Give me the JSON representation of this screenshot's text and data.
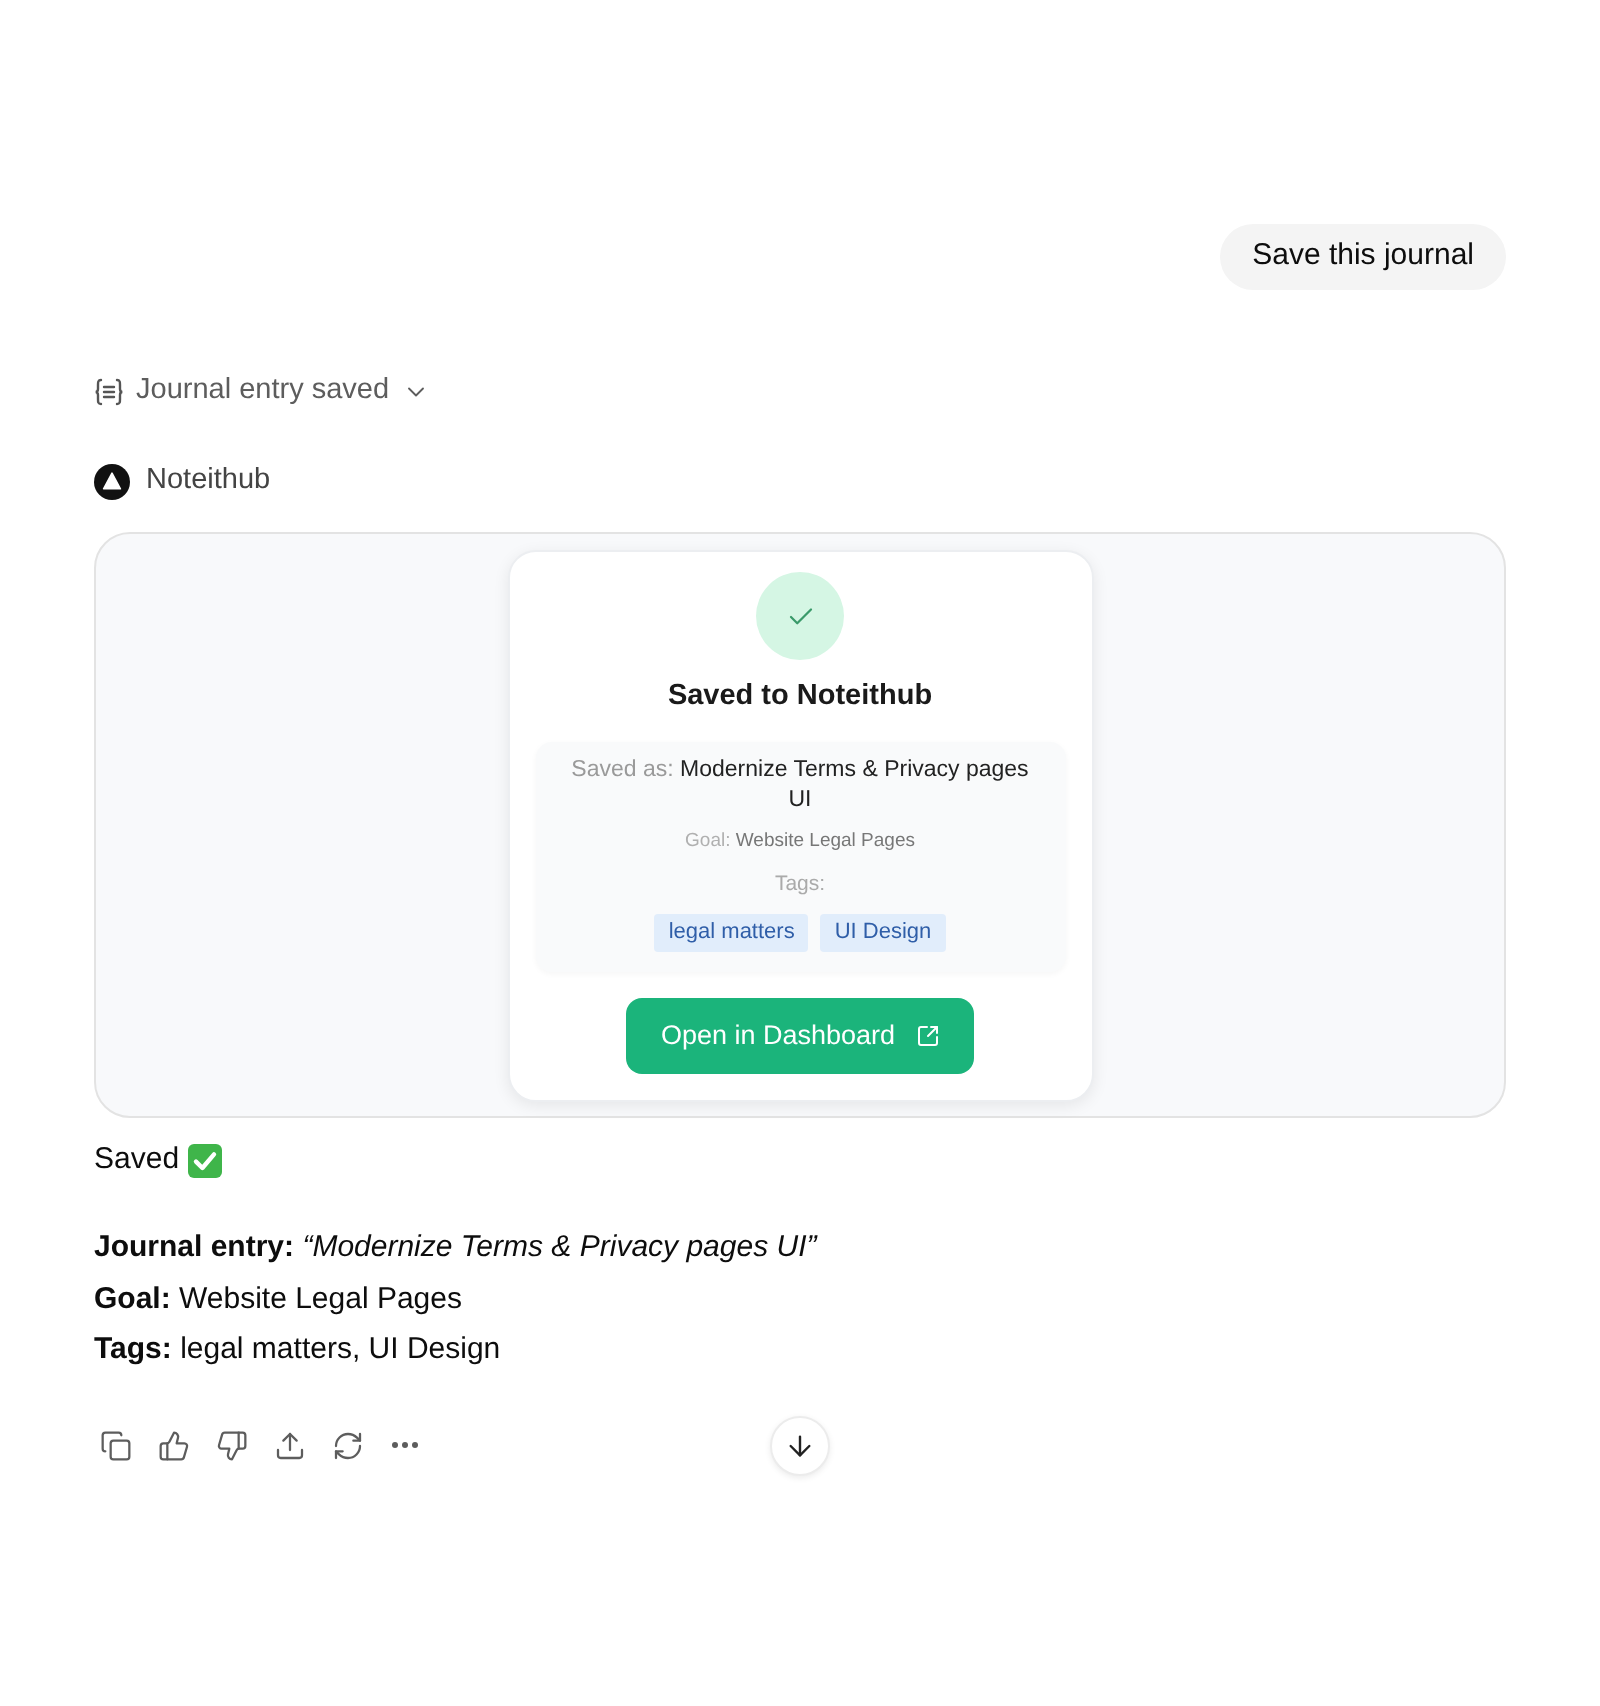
{
  "user_message": {
    "text": "Save this journal"
  },
  "tool_call": {
    "label": "Journal entry saved",
    "expanded": false
  },
  "app": {
    "name": "Noteithub"
  },
  "result_card": {
    "title": "Saved to Noteithub",
    "saved_as_label": "Saved as:",
    "saved_as_value": "Modernize Terms & Privacy pages UI",
    "goal_label": "Goal:",
    "goal_value": "Website Legal Pages",
    "tags_label": "Tags:",
    "tags": [
      "legal matters",
      "UI Design"
    ],
    "button": "Open in Dashboard"
  },
  "response": {
    "status": "Saved",
    "lines": [
      "**Journal entry:** *“Modernize Terms & Privacy pages UI”*",
      "**Goal:** Website Legal Pages",
      "**Tags:** legal matters, UI Design"
    ]
  }
}
